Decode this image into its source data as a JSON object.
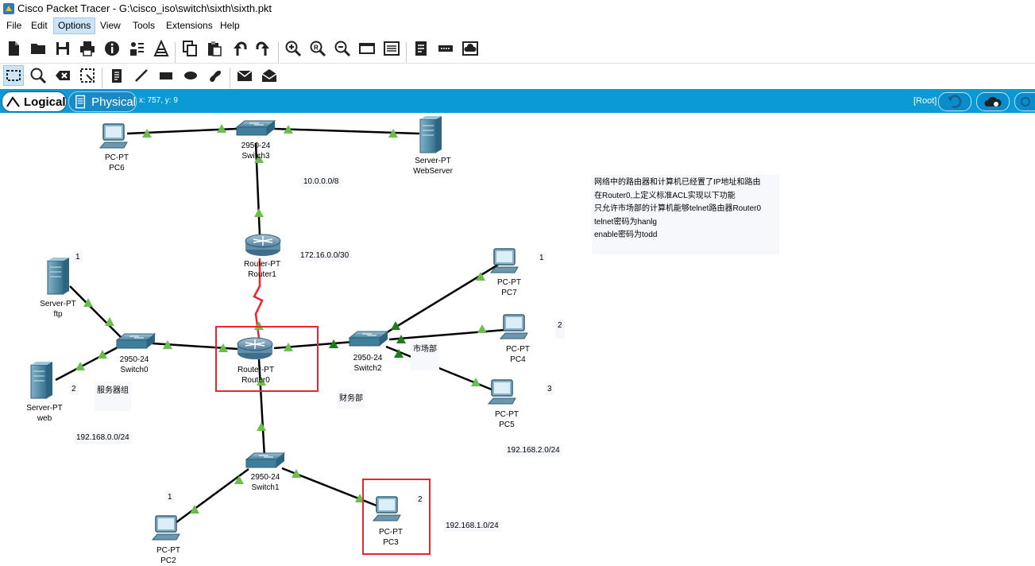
{
  "window": {
    "title": "Cisco Packet Tracer - G:\\cisco_iso\\switch\\sixth\\sixth.pkt"
  },
  "menu": [
    "File",
    "Edit",
    "Options",
    "View",
    "Tools",
    "Extensions",
    "Help"
  ],
  "tabs": {
    "logical": "Logical",
    "physical": "Physical"
  },
  "status": {
    "coords": "x: 757, y: 9",
    "root": "[Root]"
  },
  "devices": {
    "pc6": {
      "type": "PC-PT",
      "name": "PC6"
    },
    "switch3": {
      "type": "2950-24",
      "name": "Switch3"
    },
    "webserver": {
      "type": "Server-PT",
      "name": "WebServer"
    },
    "router1": {
      "type": "Router-PT",
      "name": "Router1"
    },
    "ftp": {
      "type": "Server-PT",
      "name": "ftp"
    },
    "web": {
      "type": "Server-PT",
      "name": "web"
    },
    "switch0": {
      "type": "2950-24",
      "name": "Switch0"
    },
    "router0": {
      "type": "Router-PT",
      "name": "Router0"
    },
    "switch2": {
      "type": "2950-24",
      "name": "Switch2"
    },
    "pc7": {
      "type": "PC-PT",
      "name": "PC7"
    },
    "pc4": {
      "type": "PC-PT",
      "name": "PC4"
    },
    "pc5": {
      "type": "PC-PT",
      "name": "PC5"
    },
    "switch1": {
      "type": "2950-24",
      "name": "Switch1"
    },
    "pc2": {
      "type": "PC-PT",
      "name": "PC2"
    },
    "pc3": {
      "type": "PC-PT",
      "name": "PC3"
    }
  },
  "notes": {
    "net10": "10.0.0.0/8",
    "net172": "172.16.0.0/30",
    "net192_0": "192.168.0.0/24",
    "net192_1": "192.168.1.0/24",
    "net192_2": "192.168.2.0/24",
    "server_group": "服务器组",
    "finance": "财务部",
    "market": "市场部",
    "n1a": "1",
    "n2a": "2",
    "n1b": "1",
    "n2b": "2",
    "n3b": "3",
    "n1c": "1",
    "n2c": "2"
  },
  "task": [
    "网络中的路由器和计算机已经置了IP地址和路由",
    "在Router0,上定义标准ACL实现以下功能",
    "只允许市场部的计算机能够telnet路由器Router0",
    "telnet密码为hanlg",
    "enable密码为todd"
  ],
  "colors": {
    "topbar": "#0a9ad6",
    "link": "#000000",
    "serial": "#e8262f",
    "port_up": "#6abf4b",
    "port_dark": "#1a7f1a",
    "highlight": "#e8262f"
  }
}
